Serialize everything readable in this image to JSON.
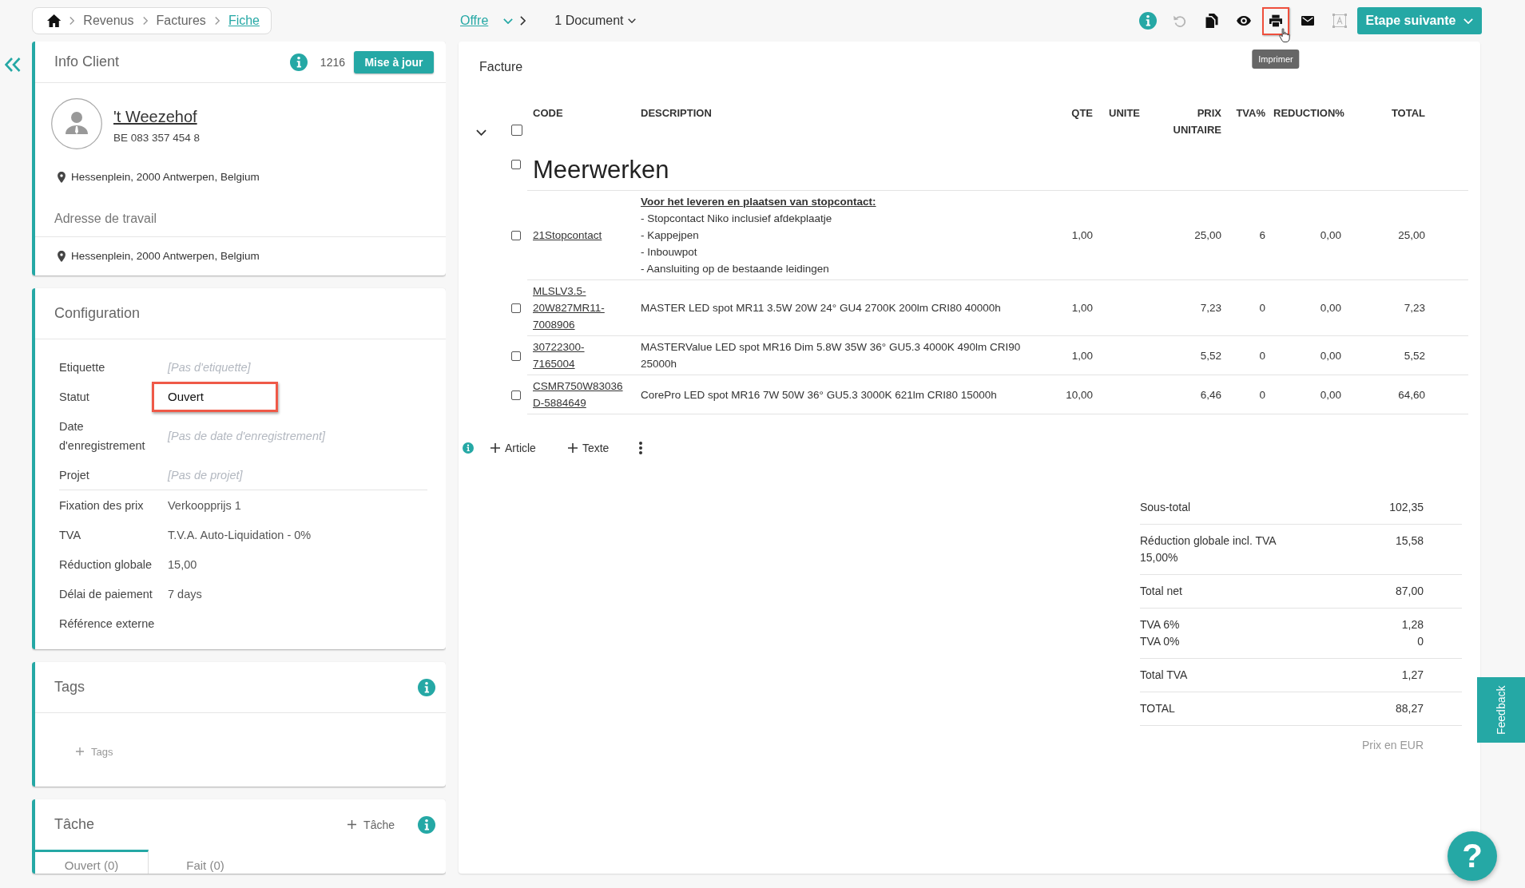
{
  "breadcrumb": [
    {
      "label": "Revenus",
      "selected": false
    },
    {
      "label": "Factures",
      "selected": false
    },
    {
      "label": "Fiche",
      "selected": true
    }
  ],
  "document_nav": {
    "document_type": "Offre",
    "documents": "1 Document"
  },
  "toolbar": {
    "tools": [
      {
        "kind": "info",
        "disabled": false,
        "highlighted": false
      },
      {
        "kind": "undo",
        "disabled": true,
        "highlighted": false
      },
      {
        "kind": "copy",
        "disabled": false,
        "highlighted": false
      },
      {
        "kind": "preview",
        "disabled": false,
        "highlighted": false
      },
      {
        "kind": "print",
        "disabled": false,
        "highlighted": true,
        "tooltip": "Imprimer"
      },
      {
        "kind": "mail",
        "disabled": false,
        "highlighted": false
      },
      {
        "kind": "text-frame",
        "disabled": true,
        "highlighted": false
      }
    ],
    "next_step": "Etape suivante"
  },
  "client_card": {
    "title": "Info Client",
    "number": "1216",
    "update_button": "Mise à jour",
    "name": "'t Weezehof",
    "vat_number": "BE 083 357 454 8",
    "address": "Hessenplein, 2000 Antwerpen, Belgium",
    "work_address_title": "Adresse de travail",
    "work_address": "Hessenplein, 2000 Antwerpen, Belgium"
  },
  "configuration": {
    "title": "Configuration",
    "groups": [
      {
        "fields": [
          {
            "label": "Etiquette",
            "placeholder": "[Pas d'etiquette]",
            "highlighted": false
          },
          {
            "label": "Statut",
            "value": "Ouvert",
            "highlighted": true
          },
          {
            "label": "Date d'enregistrement",
            "placeholder": "[Pas de date d'enregistrement]",
            "highlighted": false
          },
          {
            "label": "Projet",
            "placeholder": "[Pas de projet]",
            "highlighted": false
          }
        ]
      },
      {
        "fields": [
          {
            "label": "Fixation des prix",
            "value": "Verkoopprijs 1",
            "highlighted": false
          },
          {
            "label": "TVA",
            "value": "T.V.A. Auto-Liquidation - 0%",
            "highlighted": false
          },
          {
            "label": "Réduction globale",
            "value": "15,00",
            "highlighted": false
          },
          {
            "label": "Délai de paiement",
            "value": "7 days",
            "highlighted": false
          },
          {
            "label": "Référence externe",
            "highlighted": false
          }
        ]
      }
    ]
  },
  "tags_card": {
    "title": "Tags",
    "add_button": "Tags"
  },
  "task_card": {
    "title": "Tâche",
    "add_button": "Tâche",
    "tabs": [
      {
        "label": "Ouvert (0)",
        "selected": true
      },
      {
        "label": "Fait (0)",
        "selected": false
      }
    ]
  },
  "invoice": {
    "title": "Facture",
    "expanded": true,
    "checked": false,
    "columns": [
      "CODE",
      "DESCRIPTION",
      "QTE",
      "UNITE",
      "PRIX UNITAIRE",
      "TVA%",
      "REDUCTION%",
      "TOTAL"
    ],
    "groups": [
      {
        "title": "Meerwerken",
        "checked": false,
        "rows": [
          {
            "checked": false,
            "code": "21Stopcontact",
            "description_title": "Voor het leveren en plaatsen van stopcontact:",
            "description": [
              "- Stopcontact Niko inclusief afdekplaatje",
              "- Kappejpen",
              "- Inbouwpot",
              "- Aansluiting op de bestaande leidingen"
            ],
            "qty": "1,00",
            "unit_price": "25,00",
            "vat": "6",
            "reduction": "0,00",
            "total": "25,00"
          },
          {
            "checked": false,
            "code": "MLSLV3.5-20W827MR11-7008906",
            "description": [
              "MASTER LED spot MR11 3.5W 20W 24° GU4 2700K 200lm CRI80 40000h"
            ],
            "qty": "1,00",
            "unit_price": "7,23",
            "vat": "0",
            "reduction": "0,00",
            "total": "7,23"
          },
          {
            "checked": false,
            "code": "30722300-7165004",
            "description": [
              "MASTERValue LED spot MR16 Dim 5.8W 35W 36° GU5.3 4000K 490lm CRI90 25000h"
            ],
            "qty": "1,00",
            "unit_price": "5,52",
            "vat": "0",
            "reduction": "0,00",
            "total": "5,52"
          },
          {
            "checked": false,
            "code": "CSMR750W83036D-5884649",
            "description": [
              "CorePro LED spot MR16 7W 50W 36° GU5.3 3000K 621lm CRI80 15000h"
            ],
            "qty": "10,00",
            "unit_price": "6,46",
            "vat": "0",
            "reduction": "0,00",
            "total": "64,60"
          }
        ]
      }
    ],
    "actions": [
      {
        "label": "Article"
      },
      {
        "label": "Texte"
      }
    ]
  },
  "totals": {
    "groups": [
      {
        "lines": [
          {
            "label": "Sous-total",
            "value": "102,35"
          }
        ]
      },
      {
        "lines": [
          {
            "label": "Réduction globale incl. TVA",
            "value": "15,58"
          },
          {
            "label": "15,00%"
          }
        ]
      },
      {
        "lines": [
          {
            "label": "Total net",
            "value": "87,00"
          }
        ]
      },
      {
        "lines": [
          {
            "label": "TVA 6%",
            "value": "1,28"
          },
          {
            "label": "TVA 0%",
            "value": "0"
          }
        ]
      },
      {
        "lines": [
          {
            "label": "Total TVA",
            "value": "1,27"
          }
        ]
      },
      {
        "lines": [
          {
            "label": "TOTAL",
            "value": "88,27"
          }
        ]
      }
    ],
    "currency_note": "Prix en EUR"
  },
  "feedback_button": "Feedback",
  "help_button": "?"
}
